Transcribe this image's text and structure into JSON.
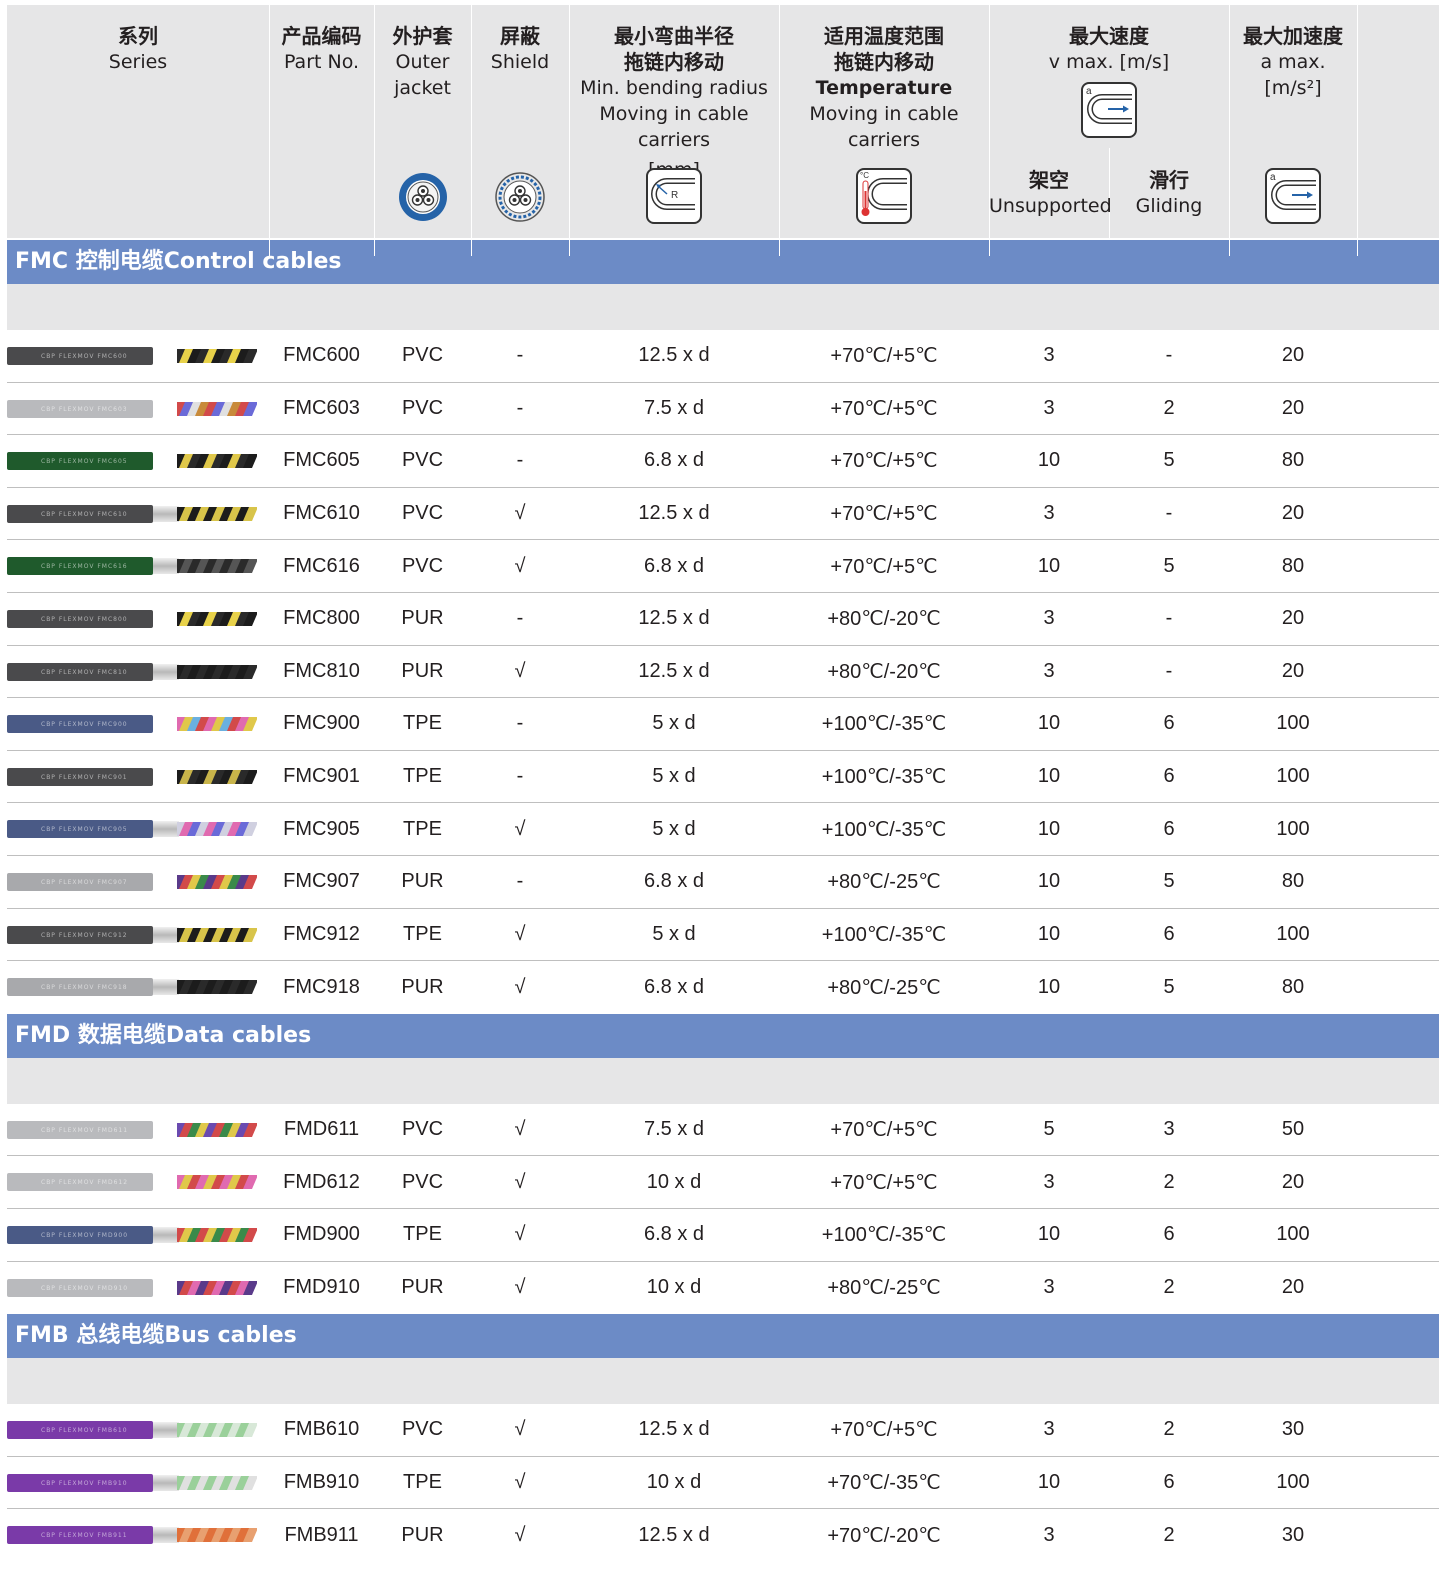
{
  "header": {
    "series": {
      "zh": "系列",
      "en": "Series"
    },
    "part_no": {
      "zh": "产品编码",
      "en": "Part No."
    },
    "outer_jacket": {
      "zh": "外护套",
      "en": "Outer\njacket",
      "icon": "cable-cross-section-icon"
    },
    "shield": {
      "zh": "屏蔽",
      "en": "Shield",
      "icon": "shielded-cable-cross-section-icon"
    },
    "bending": {
      "zh1": "最小弯曲半径",
      "zh2": "拖链内移动",
      "en1": "Min. bending radius",
      "en2": "Moving in cable carriers",
      "unit": "[mm]",
      "icon": "bending-radius-icon",
      "icon_label": "R"
    },
    "temperature": {
      "zh1": "适用温度范围",
      "zh2": "拖链内移动",
      "en1": "Temperature",
      "en2": "Moving in cable carriers",
      "icon": "thermometer-carrier-icon",
      "icon_label": "°C"
    },
    "speed": {
      "zh": "最大速度",
      "en": "v max. [m/s]",
      "icon": "speed-carrier-icon",
      "icon_label": "a",
      "unsupported": {
        "zh": "架空",
        "en": "Unsupported"
      },
      "gliding": {
        "zh": "滑行",
        "en": "Gliding"
      }
    },
    "accel": {
      "zh": "最大加速度",
      "en": "a max.",
      "unit": "[m/s²]",
      "icon": "acceleration-carrier-icon",
      "icon_label": "a"
    }
  },
  "sections": [
    {
      "title": "FMC 控制电缆Control cables",
      "rows": [
        {
          "part": "FMC600",
          "jacket": "PVC",
          "shield": "-",
          "bend": "12.5 x d",
          "temp": "+70℃/+5℃",
          "v_unsup": "3",
          "v_glide": "-",
          "accel": "20",
          "cable_color": "#4a4a4c",
          "cable_print": "CBP FLEXMOV FMC600",
          "core_colors": [
            "#2a2a2a",
            "#e8d24a",
            "#1c1c1c"
          ],
          "shielded": false
        },
        {
          "part": "FMC603",
          "jacket": "PVC",
          "shield": "-",
          "bend": "7.5 x d",
          "temp": "+70℃/+5℃",
          "v_unsup": "3",
          "v_glide": "2",
          "accel": "20",
          "cable_color": "#b9babd",
          "cable_print": "CBP FLEXMOV FMC603",
          "core_colors": [
            "#d24a4a",
            "#6a6ad8",
            "#e0e0e0",
            "#c88a3a"
          ],
          "shielded": false
        },
        {
          "part": "FMC605",
          "jacket": "PVC",
          "shield": "-",
          "bend": "6.8 x d",
          "temp": "+70℃/+5℃",
          "v_unsup": "10",
          "v_glide": "5",
          "accel": "80",
          "cable_color": "#1f5a2c",
          "cable_print": "CBP FLEXMOV FMC605",
          "core_colors": [
            "#1c1c1c",
            "#e0c84a",
            "#2a2a2a"
          ],
          "shielded": false
        },
        {
          "part": "FMC610",
          "jacket": "PVC",
          "shield": "√",
          "bend": "12.5 x d",
          "temp": "+70℃/+5℃",
          "v_unsup": "3",
          "v_glide": "-",
          "accel": "20",
          "cable_color": "#4a4a4c",
          "cable_print": "CBP FLEXMOV FMC610",
          "core_colors": [
            "#1c1c1c",
            "#d8c44a"
          ],
          "shielded": true
        },
        {
          "part": "FMC616",
          "jacket": "PVC",
          "shield": "√",
          "bend": "6.8 x d",
          "temp": "+70℃/+5℃",
          "v_unsup": "10",
          "v_glide": "5",
          "accel": "80",
          "cable_color": "#1f5a2c",
          "cable_print": "CBP FLEXMOV FMC616",
          "core_colors": [
            "#2a2a2a",
            "#555555"
          ],
          "shielded": true
        },
        {
          "part": "FMC800",
          "jacket": "PUR",
          "shield": "-",
          "bend": "12.5 x d",
          "temp": "+80℃/-20℃",
          "v_unsup": "3",
          "v_glide": "-",
          "accel": "20",
          "cable_color": "#4a4a4c",
          "cable_print": "CBP FLEXMOV FMC800",
          "core_colors": [
            "#1c1c1c",
            "#e8d24a",
            "#2a2a2a"
          ],
          "shielded": false
        },
        {
          "part": "FMC810",
          "jacket": "PUR",
          "shield": "√",
          "bend": "12.5 x d",
          "temp": "+80℃/-20℃",
          "v_unsup": "3",
          "v_glide": "-",
          "accel": "20",
          "cable_color": "#4a4a4c",
          "cable_print": "CBP FLEXMOV FMC810",
          "core_colors": [
            "#1c1c1c",
            "#2a2a2a"
          ],
          "shielded": true
        },
        {
          "part": "FMC900",
          "jacket": "TPE",
          "shield": "-",
          "bend": "5 x d",
          "temp": "+100℃/-35℃",
          "v_unsup": "10",
          "v_glide": "6",
          "accel": "100",
          "cable_color": "#4a5a86",
          "cable_print": "CBP FLEXMOV FMC900",
          "core_colors": [
            "#e06ab0",
            "#e0c84a",
            "#6ab0e0",
            "#d24a4a"
          ],
          "shielded": false
        },
        {
          "part": "FMC901",
          "jacket": "TPE",
          "shield": "-",
          "bend": "5 x d",
          "temp": "+100℃/-35℃",
          "v_unsup": "10",
          "v_glide": "6",
          "accel": "100",
          "cable_color": "#4a4a4c",
          "cable_print": "CBP FLEXMOV FMC901",
          "core_colors": [
            "#1c1c1c",
            "#c8b44a",
            "#2a2a2a"
          ],
          "shielded": false
        },
        {
          "part": "FMC905",
          "jacket": "TPE",
          "shield": "√",
          "bend": "5 x d",
          "temp": "+100℃/-35℃",
          "v_unsup": "10",
          "v_glide": "6",
          "accel": "100",
          "cable_color": "#4a5a86",
          "cable_print": "CBP FLEXMOV FMC905",
          "core_colors": [
            "#d0d0e0",
            "#e06ab0",
            "#6a6ad8"
          ],
          "shielded": true
        },
        {
          "part": "FMC907",
          "jacket": "PUR",
          "shield": "-",
          "bend": "6.8 x d",
          "temp": "+80℃/-25℃",
          "v_unsup": "10",
          "v_glide": "5",
          "accel": "80",
          "cable_color": "#a8a9ac",
          "cable_print": "CBP FLEXMOV FMC907",
          "core_colors": [
            "#5a3a8a",
            "#d24a4a",
            "#e0c84a",
            "#3a8a4a"
          ],
          "shielded": false
        },
        {
          "part": "FMC912",
          "jacket": "TPE",
          "shield": "√",
          "bend": "5 x d",
          "temp": "+100℃/-35℃",
          "v_unsup": "10",
          "v_glide": "6",
          "accel": "100",
          "cable_color": "#4a4a4c",
          "cable_print": "CBP FLEXMOV FMC912",
          "core_colors": [
            "#1c1c1c",
            "#d8c44a"
          ],
          "shielded": true
        },
        {
          "part": "FMC918",
          "jacket": "PUR",
          "shield": "√",
          "bend": "6.8 x d",
          "temp": "+80℃/-25℃",
          "v_unsup": "10",
          "v_glide": "5",
          "accel": "80",
          "cable_color": "#a8a9ac",
          "cable_print": "CBP FLEXMOV FMC918",
          "core_colors": [
            "#1c1c1c",
            "#2a2a2a"
          ],
          "shielded": true
        }
      ]
    },
    {
      "title": "FMD 数据电缆Data cables",
      "rows": [
        {
          "part": "FMD611",
          "jacket": "PVC",
          "shield": "√",
          "bend": "7.5 x d",
          "temp": "+70℃/+5℃",
          "v_unsup": "5",
          "v_glide": "3",
          "accel": "50",
          "cable_color": "#b9babd",
          "cable_print": "CBP FLEXMOV FMD611",
          "core_colors": [
            "#6a4ab0",
            "#d24a4a",
            "#3a8a4a",
            "#e0c84a"
          ],
          "shielded": false
        },
        {
          "part": "FMD612",
          "jacket": "PVC",
          "shield": "√",
          "bend": "10 x d",
          "temp": "+70℃/+5℃",
          "v_unsup": "3",
          "v_glide": "2",
          "accel": "20",
          "cable_color": "#b9babd",
          "cable_print": "CBP FLEXMOV FMD612",
          "core_colors": [
            "#e06ab0",
            "#e0c84a",
            "#d24a4a"
          ],
          "shielded": false
        },
        {
          "part": "FMD900",
          "jacket": "TPE",
          "shield": "√",
          "bend": "6.8 x d",
          "temp": "+100℃/-35℃",
          "v_unsup": "10",
          "v_glide": "6",
          "accel": "100",
          "cable_color": "#4a5a86",
          "cable_print": "CBP FLEXMOV FMD900",
          "core_colors": [
            "#d24a4a",
            "#e0c84a",
            "#3a8a4a"
          ],
          "shielded": true
        },
        {
          "part": "FMD910",
          "jacket": "PUR",
          "shield": "√",
          "bend": "10 x d",
          "temp": "+80℃/-25℃",
          "v_unsup": "3",
          "v_glide": "2",
          "accel": "20",
          "cable_color": "#b9babd",
          "cable_print": "CBP FLEXMOV FMD910",
          "core_colors": [
            "#5a3a8a",
            "#d24a4a",
            "#e06ab0"
          ],
          "shielded": false
        }
      ]
    },
    {
      "title": "FMB 总线电缆Bus cables",
      "rows": [
        {
          "part": "FMB610",
          "jacket": "PVC",
          "shield": "√",
          "bend": "12.5 x d",
          "temp": "+70℃/+5℃",
          "v_unsup": "3",
          "v_glide": "2",
          "accel": "30",
          "cable_color": "#7a3aa8",
          "cable_print": "CBP FLEXMOV FMB610",
          "core_colors": [
            "#9ad09a",
            "#d8e8d8"
          ],
          "shielded": true
        },
        {
          "part": "FMB910",
          "jacket": "TPE",
          "shield": "√",
          "bend": "10 x d",
          "temp": "+70℃/-35℃",
          "v_unsup": "10",
          "v_glide": "6",
          "accel": "100",
          "cable_color": "#7a3aa8",
          "cable_print": "CBP FLEXMOV FMB910",
          "core_colors": [
            "#9ad09a",
            "#e0e0e0"
          ],
          "shielded": true
        },
        {
          "part": "FMB911",
          "jacket": "PUR",
          "shield": "√",
          "bend": "12.5 x d",
          "temp": "+70℃/-20℃",
          "v_unsup": "3",
          "v_glide": "2",
          "accel": "30",
          "cable_color": "#7a3aa8",
          "cable_print": "CBP FLEXMOV FMB911",
          "core_colors": [
            "#e0703a",
            "#e8a070"
          ],
          "shielded": true
        }
      ]
    }
  ]
}
